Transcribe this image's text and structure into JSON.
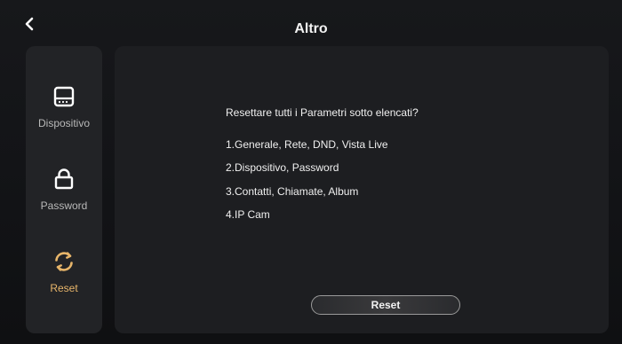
{
  "header": {
    "title": "Altro",
    "back_icon": "chevron-left-icon"
  },
  "sidebar": {
    "items": [
      {
        "label": "Dispositivo",
        "icon": "device-screen-icon",
        "active": false
      },
      {
        "label": "Password",
        "icon": "lock-icon",
        "active": false
      },
      {
        "label": "Reset",
        "icon": "refresh-icon",
        "active": true
      }
    ]
  },
  "main": {
    "question": "Resettare tutti i Parametri sotto elencati?",
    "items": [
      "1.Generale, Rete, DND, Vista Live",
      "2.Dispositivo, Password",
      "3.Contatti, Chiamate, Album",
      "4.IP Cam"
    ],
    "reset_button": "Reset"
  },
  "colors": {
    "accent": "#e7b56a",
    "text": "#f0f0f0",
    "muted": "#b9b9b9"
  }
}
